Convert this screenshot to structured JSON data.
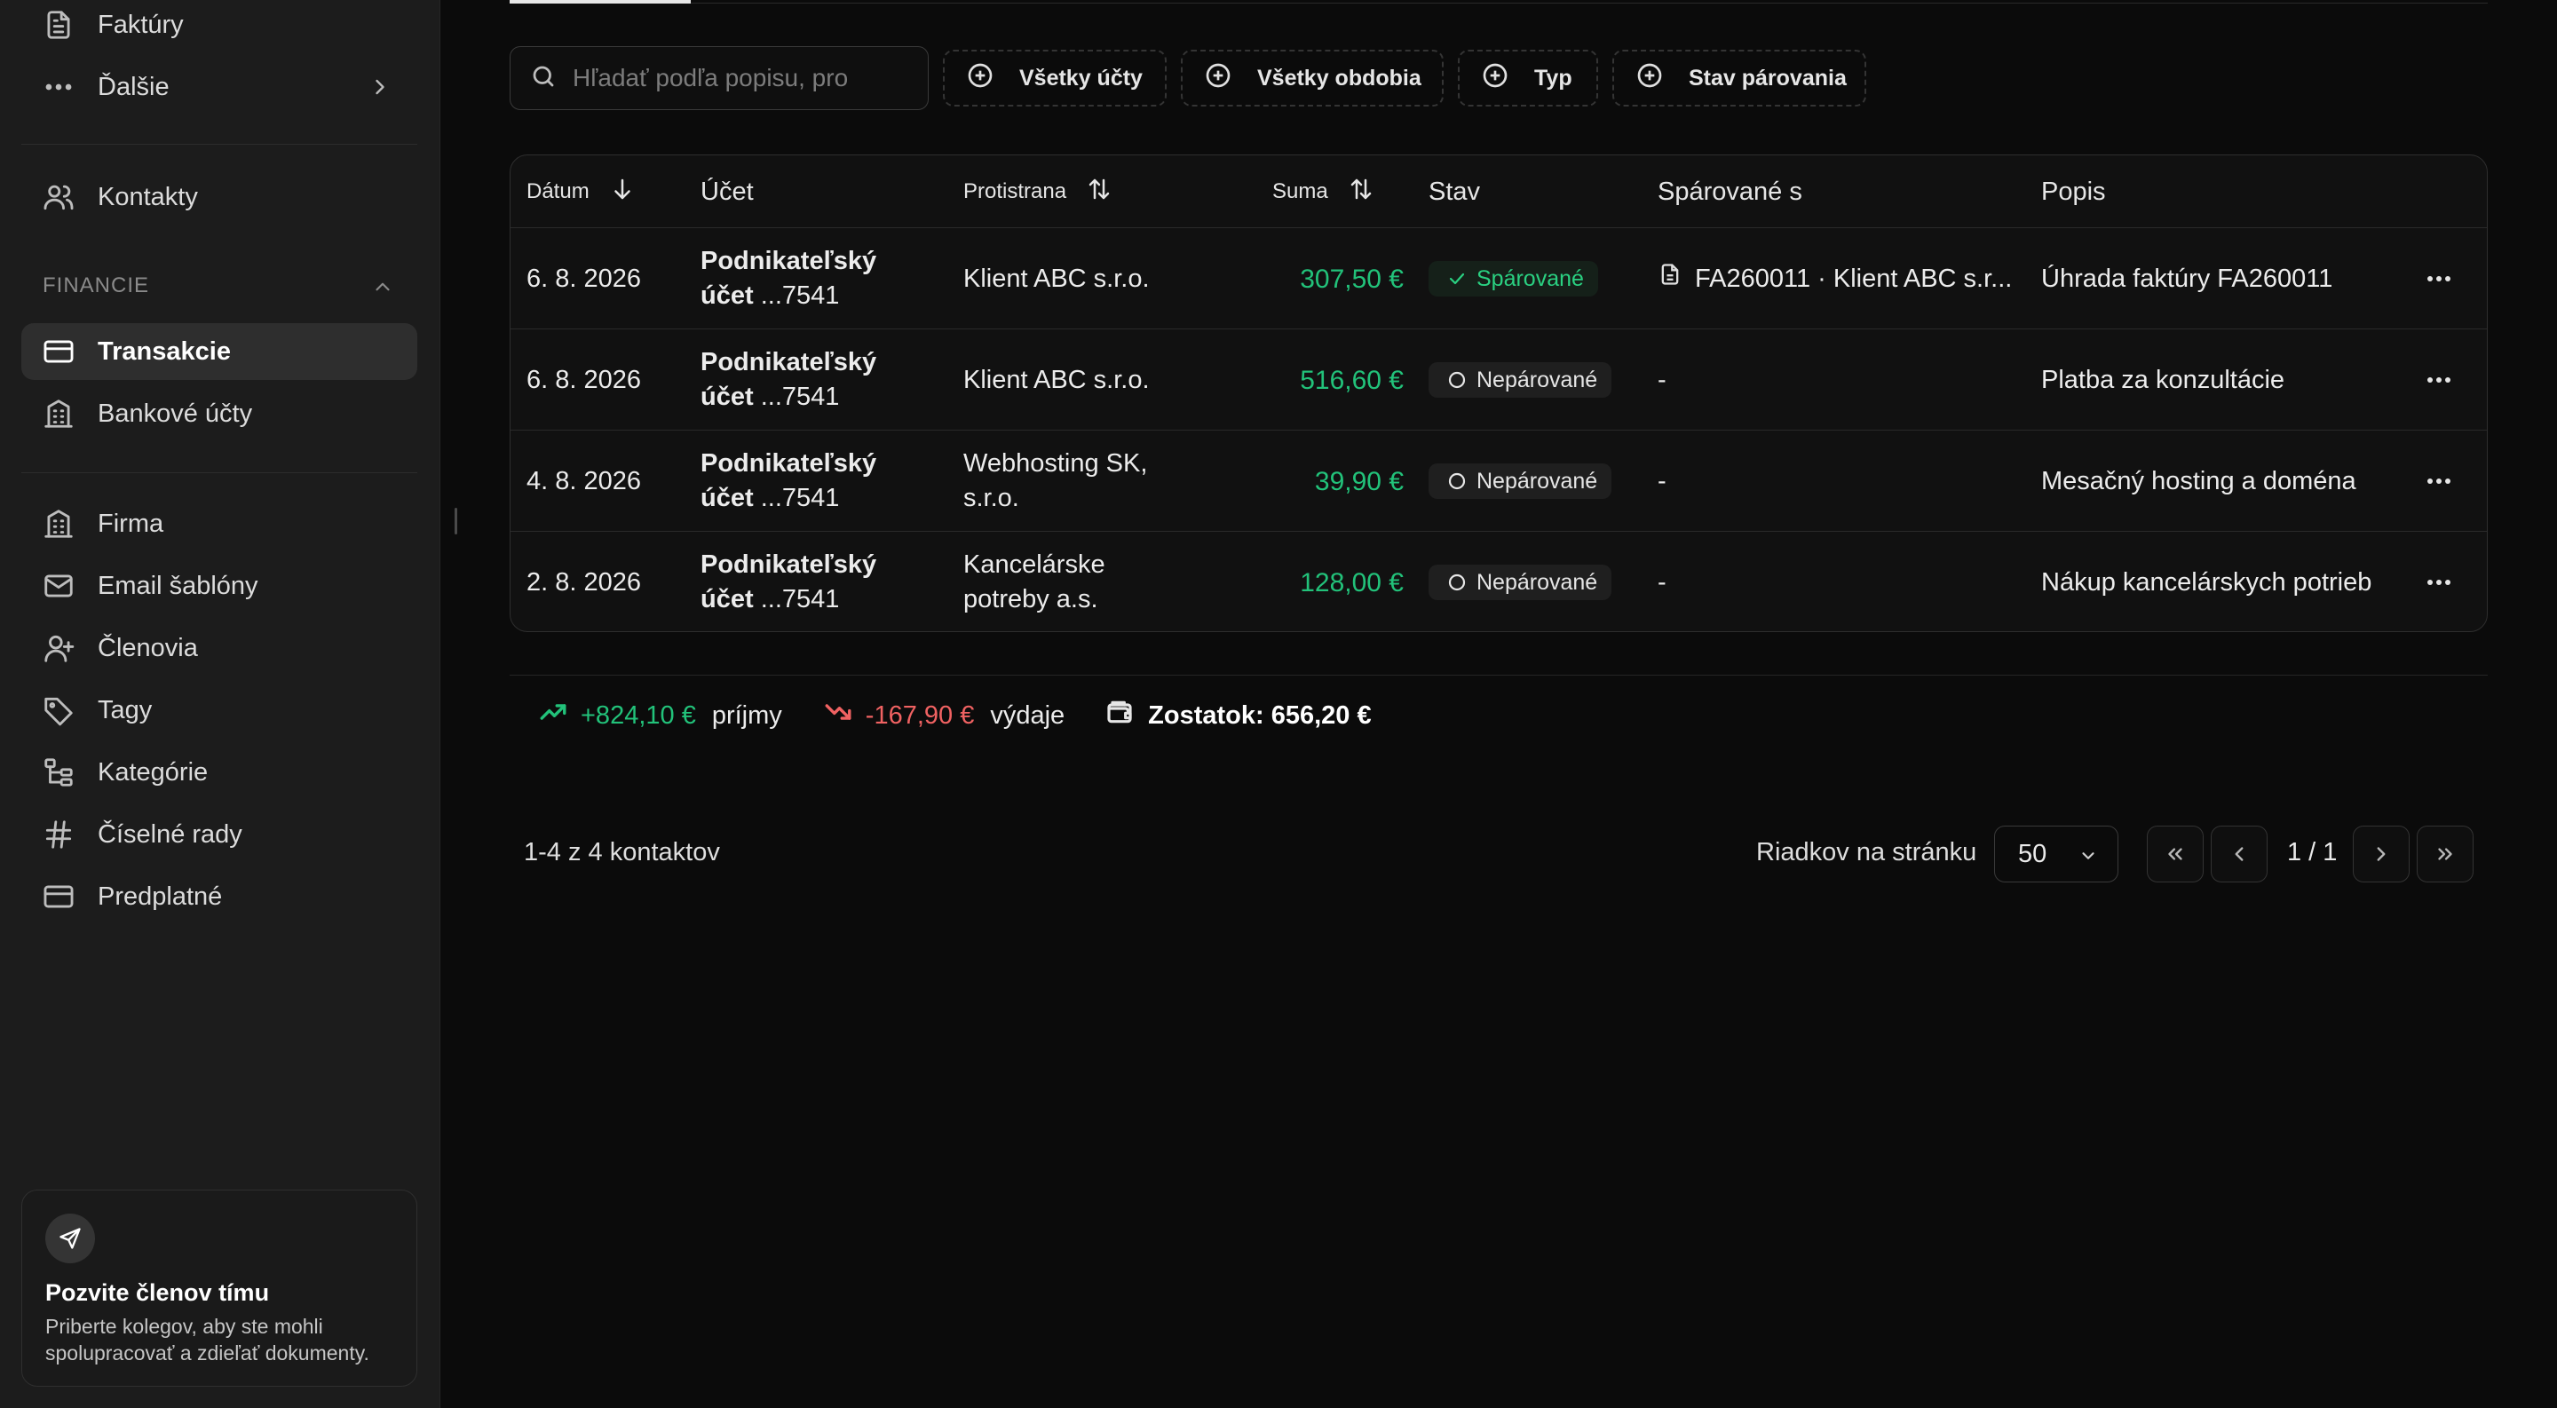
{
  "sidebar": {
    "top_items": [
      {
        "label": "Faktúry",
        "icon": "document-icon"
      },
      {
        "label": "Ďalšie",
        "icon": "more-horizontal-icon"
      }
    ],
    "contacts": {
      "label": "Kontakty",
      "icon": "users-icon"
    },
    "section_label": "FINANCIE",
    "finance_items": [
      {
        "label": "Transakcie",
        "icon": "credit-card-icon",
        "active": true
      },
      {
        "label": "Bankové účty",
        "icon": "building-icon"
      }
    ],
    "settings_items": [
      {
        "label": "Firma",
        "icon": "building-icon"
      },
      {
        "label": "Email šablóny",
        "icon": "mail-icon"
      },
      {
        "label": "Členovia",
        "icon": "user-plus-icon"
      },
      {
        "label": "Tagy",
        "icon": "tag-icon"
      },
      {
        "label": "Kategórie",
        "icon": "category-tree-icon"
      },
      {
        "label": "Číselné rady",
        "icon": "hash-icon"
      },
      {
        "label": "Predplatné",
        "icon": "credit-card-icon"
      }
    ],
    "invite": {
      "title": "Pozvite členov tímu",
      "description": "Priberte kolegov, aby ste mohli spolupracovať a zdieľať dokumenty."
    }
  },
  "toolbar": {
    "search_placeholder": "Hľadať podľa popisu, pro",
    "filters": [
      "Všetky účty",
      "Všetky obdobia",
      "Typ",
      "Stav párovania"
    ]
  },
  "table": {
    "columns": {
      "date": "Dátum",
      "account": "Účet",
      "counterparty": "Protistrana",
      "amount": "Suma",
      "status": "Stav",
      "matched_with": "Spárované s",
      "description": "Popis"
    },
    "rows": [
      {
        "date": "6. 8. 2026",
        "account_name": "Podnikateľský",
        "account_num_prefix": "účet",
        "account_num": "...7541",
        "counterparty": "Klient ABC s.r.o.",
        "amount": "307,50 €",
        "status": "Spárované",
        "status_type": "matched",
        "matched_with": "FA260011 · Klient ABC s.r...",
        "description": "Úhrada faktúry FA260011"
      },
      {
        "date": "6. 8. 2026",
        "account_name": "Podnikateľský",
        "account_num_prefix": "účet",
        "account_num": "...7541",
        "counterparty": "Klient ABC s.r.o.",
        "amount": "516,60 €",
        "status": "Nepárované",
        "status_type": "unmatched",
        "matched_with": "-",
        "description": "Platba za konzultácie"
      },
      {
        "date": "4. 8. 2026",
        "account_name": "Podnikateľský",
        "account_num_prefix": "účet",
        "account_num": "...7541",
        "counterparty": "Webhosting SK, s.r.o.",
        "amount": "39,90 €",
        "status": "Nepárované",
        "status_type": "unmatched",
        "matched_with": "-",
        "description": "Mesačný hosting a doména"
      },
      {
        "date": "2. 8. 2026",
        "account_name": "Podnikateľský",
        "account_num_prefix": "účet",
        "account_num": "...7541",
        "counterparty": "Kancelárske potreby a.s.",
        "amount": "128,00 €",
        "status": "Nepárované",
        "status_type": "unmatched",
        "matched_with": "-",
        "description": "Nákup kancelárskych potrieb"
      }
    ]
  },
  "summary": {
    "income_value": "+824,10 €",
    "income_label": "príjmy",
    "expense_value": "-167,90 €",
    "expense_label": "výdaje",
    "balance": "Zostatok: 656,20 €"
  },
  "pagination": {
    "count_text": "1-4 z 4 kontaktov",
    "rows_per_page_label": "Riadkov na stránku",
    "rows_per_page_value": "50",
    "page_text": "1 / 1"
  },
  "colors": {
    "positive": "#22c27a",
    "negative": "#f06262",
    "background": "#0b0b0b",
    "sidebar": "#1c1c1c"
  }
}
